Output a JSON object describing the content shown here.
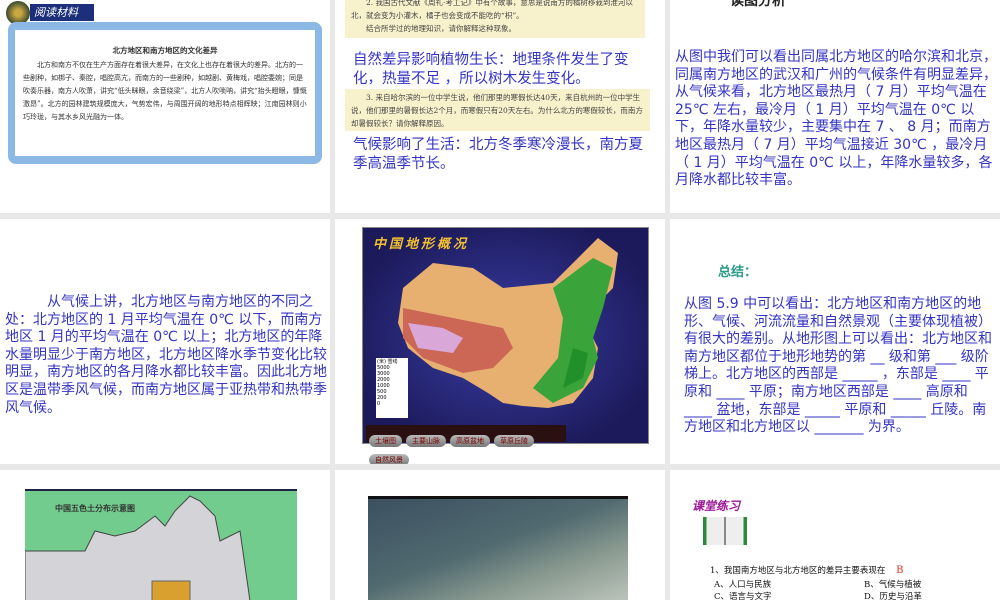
{
  "slides": [
    {
      "banner": "阅读材料",
      "title": "北方地区和南方地区的文化差异",
      "body": "北方和南方不仅在生产方面存在着很大差异，在文化上也存在着很大的差异。北方的一些剧种，如梆子、秦腔，唱腔高亢，而南方的一些剧种，如越剧、黄梅戏，唱腔委婉；同是吹奏乐器，南方人吹萧，讲究“低头眯眼，余音绕梁”，北方人吹唢呐，讲究“抬头瞪眼，慷慨激昂”。北方的园林建筑规模庞大，气势宏伟，与周围开阔的地形特点相辉映；江南园林则小巧玲珑，与其水乡风光融为一体。"
    },
    {
      "q2": "2. 我国古代文献《周礼·考工记》中有个故事，意思是说南方的橘树移栽到淮河以北，就会变为小灌木，橘子也会变成不能吃的“枳”。",
      "q2b": "结合所学过的地理知识，请你解释这种现象。",
      "a2": "自然差异影响植物生长：地理条件发生了变化，热量不足 ，所以树木发生变化。",
      "q3": "3. 来自哈尔滨的一位中学生说，他们那里的寒假长达40天，来自杭州的一位中学生说，他们那里的暑假长达2个月，而寒假只有20天左右。为什么北方的寒假较长，而南方却暑假较长？请你解释原因。",
      "a3": "气候影响了生活：北方冬季寒冷漫长，南方夏季高温季节长。"
    },
    {
      "title": "读图分析",
      "body": "从图中我们可以看出同属北方地区的哈尔滨和北京，同属南方地区的武汉和广州的气候条件有明显差异，从气候来看，北方地区最热月（ 7 月）平均气温在 25℃ 左右，最冷月（ 1 月）平均气温在 0℃ 以下，年降水量较少，主要集中在 7 、 8 月；而南方地区最热月（ 7 月）平均气温接近 30℃ ，最冷月（ 1 月）平均气温在 0℃ 以上，年降水量较多，各月降水都比较丰富。"
    },
    {
      "body": "从气候上讲，北方地区与南方地区的不同之处：北方地区的 1 月平均气温在 0℃ 以下，而南方地区 1 月的平均气温在 0℃ 以上；北方地区的年降水量明显少于南方地区，北方地区降水季节变化比较明显，南方地区的各月降水都比较丰富。因此北方地区是温带季风气候，而南方地区属于亚热带和热带季风气候。"
    },
    {
      "map_title": "中国地形概况",
      "legend_title": "(米) 雪线",
      "legend": [
        "5000",
        "3000",
        "2000",
        "1000",
        "500",
        "200",
        "0"
      ],
      "buttons": [
        "土壤图",
        "主要山脉",
        "高原盆地",
        "草原丘陵",
        "自然风景"
      ]
    },
    {
      "title": "总结：",
      "body": "从图 5.9 中可以看出：北方地区和南方地区的地形、气候、河流流量和自然景观（主要体现植被）有很大的差别。从地形图上可以看出：北方地区和南方地区都位于地形地势的第 __ 级和第 ___ 级阶梯上。北方地区的西部是 _____ ，东部是 ____ 平原和 ____ 平原；南方地区西部是 ____ 高原和 ____ 盆地，东部是 _____ 平原和 _____ 丘陵。南方地区和北方地区以 _______ 为界。"
    },
    {
      "map_title": "中国五色土分布示意图"
    },
    {},
    {
      "title": "课堂练习",
      "question": "1、我国南方地区与北方地区的差异主要表现在",
      "answer": "B",
      "options": [
        "A、人口与民族",
        "B、气候与植被",
        "C、语言与文字",
        "D、历史与沿革"
      ]
    }
  ],
  "colors": {
    "text_blue": "#3434c4",
    "gap": "#e8e8e8"
  }
}
